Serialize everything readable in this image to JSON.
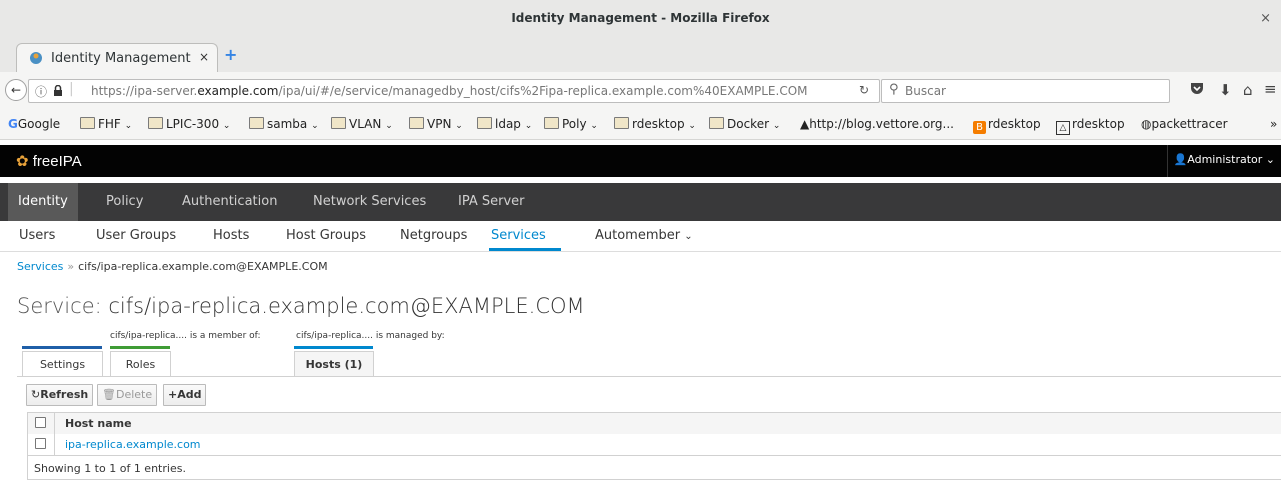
{
  "window": {
    "title": "Identity Management - Mozilla Firefox",
    "close_glyph": "×"
  },
  "browser": {
    "tab": {
      "label": "Identity Management",
      "close_glyph": "×"
    },
    "new_tab_glyph": "+",
    "url": {
      "prefix": "https://ipa-server.",
      "domain": "example.com",
      "path": "/ipa/ui/#/e/service/managedby_host/cifs%2Fipa-replica.example.com%40EXAMPLE.COM"
    },
    "search_placeholder": "Buscar",
    "bookmarks": [
      {
        "label": "Google",
        "type": "google"
      },
      {
        "label": "FHF",
        "type": "folder"
      },
      {
        "label": "LPIC-300",
        "type": "folder"
      },
      {
        "label": "samba",
        "type": "folder"
      },
      {
        "label": "VLAN",
        "type": "folder"
      },
      {
        "label": "VPN",
        "type": "folder"
      },
      {
        "label": "ldap",
        "type": "folder"
      },
      {
        "label": "Poly",
        "type": "folder"
      },
      {
        "label": "rdesktop",
        "type": "folder"
      },
      {
        "label": "Docker",
        "type": "folder"
      },
      {
        "label": "http://blog.vettore.org...",
        "type": "link"
      },
      {
        "label": "rdesktop",
        "type": "blogger"
      },
      {
        "label": "rdesktop",
        "type": "linux"
      },
      {
        "label": "packettracer",
        "type": "link"
      }
    ],
    "bookmarks_overflow": "»"
  },
  "ipa": {
    "brand": "freeIPA",
    "user": "Administrator",
    "main_nav": [
      "Identity",
      "Policy",
      "Authentication",
      "Network Services",
      "IPA Server"
    ],
    "sub_nav": [
      "Users",
      "User Groups",
      "Hosts",
      "Host Groups",
      "Netgroups",
      "Services",
      "Automember"
    ],
    "breadcrumb": {
      "link": "Services",
      "separator": "»",
      "current": "cifs/ipa-replica.example.com@EXAMPLE.COM"
    },
    "title_prefix": "Service:",
    "title_name": "cifs/ipa-replica.example.com@EXAMPLE.COM",
    "facet_groups": {
      "member_of": "cifs/ipa-replica.... is a member of:",
      "managed_by": "cifs/ipa-replica.... is managed by:"
    },
    "facets": {
      "settings": "Settings",
      "roles": "Roles",
      "hosts": "Hosts (1)"
    },
    "buttons": {
      "refresh": "Refresh",
      "delete": "Delete",
      "add": "Add"
    },
    "table": {
      "header": "Host name",
      "rows": [
        "ipa-replica.example.com"
      ],
      "footer": "Showing 1 to 1 of 1 entries."
    },
    "colors": {
      "accent": "#0088ce",
      "header_bg": "#030303",
      "nav_bg": "#39393a"
    }
  }
}
